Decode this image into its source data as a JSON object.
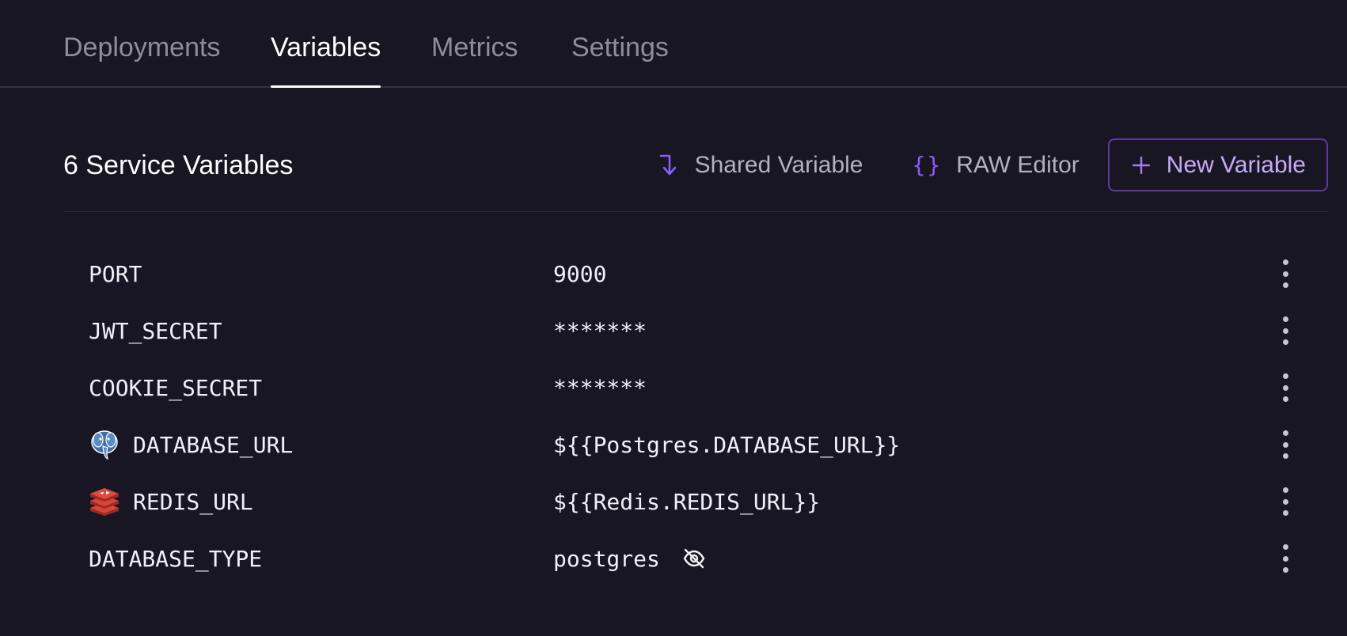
{
  "tabs": [
    {
      "label": "Deployments",
      "active": false
    },
    {
      "label": "Variables",
      "active": true
    },
    {
      "label": "Metrics",
      "active": false
    },
    {
      "label": "Settings",
      "active": false
    }
  ],
  "header": {
    "title": "6 Service Variables",
    "shared_label": "Shared Variable",
    "raw_label": "RAW Editor",
    "new_label": "New Variable"
  },
  "variables": [
    {
      "name": "PORT",
      "value": "9000"
    },
    {
      "name": "JWT_SECRET",
      "value": "*******"
    },
    {
      "name": "COOKIE_SECRET",
      "value": "*******"
    },
    {
      "name": "DATABASE_URL",
      "value": "${{Postgres.DATABASE_URL}}",
      "icon": "postgres-icon"
    },
    {
      "name": "REDIS_URL",
      "value": "${{Redis.REDIS_URL}}",
      "icon": "redis-icon"
    },
    {
      "name": "DATABASE_TYPE",
      "value": "postgres",
      "icon": "eye-off-icon"
    }
  ],
  "colors": {
    "background": "#181622",
    "accent": "#8b5cf6",
    "accent_text": "#c8aaf8",
    "muted_text": "#8f8c9c"
  }
}
